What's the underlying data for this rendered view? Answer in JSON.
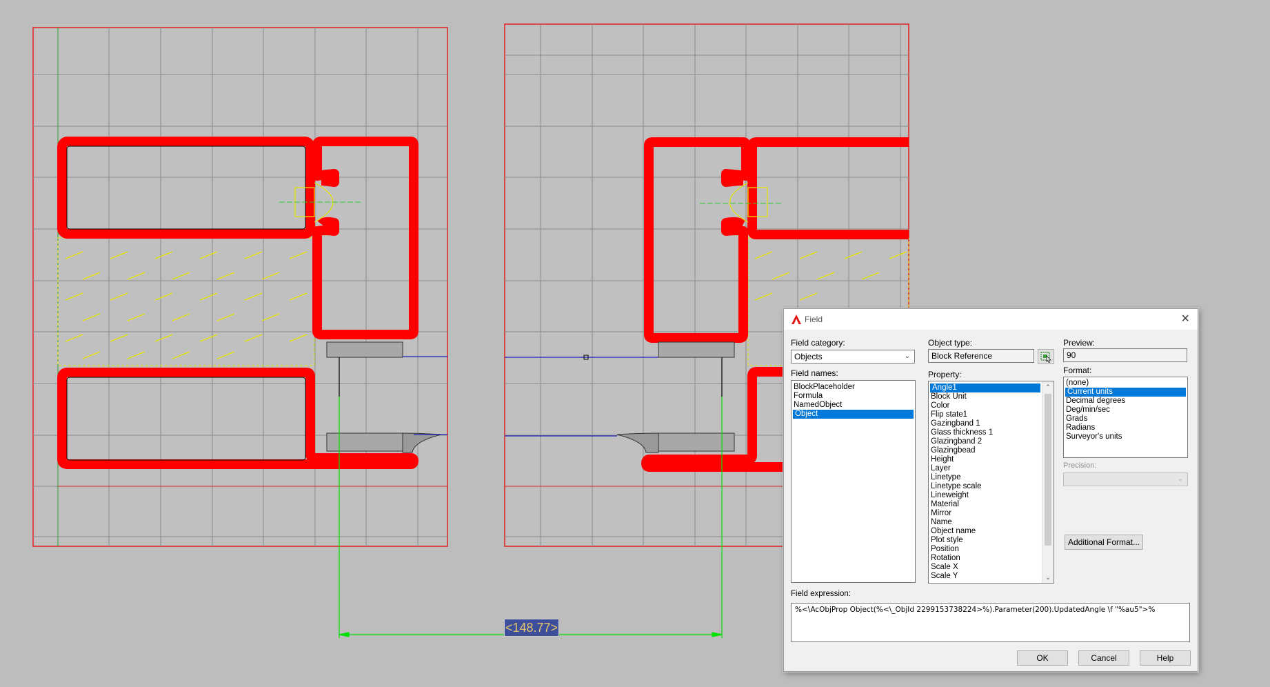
{
  "dimension": {
    "text": "<148.77>"
  },
  "dialog": {
    "title": "Field",
    "field_category": {
      "label": "Field category:",
      "value": "Objects"
    },
    "field_names": {
      "label": "Field names:",
      "items": [
        "BlockPlaceholder",
        "Formula",
        "NamedObject",
        "Object"
      ],
      "selected": "Object"
    },
    "object_type": {
      "label": "Object type:",
      "value": "Block Reference"
    },
    "property": {
      "label": "Property:",
      "items": [
        "Angle1",
        "Block Unit",
        "Color",
        "Flip state1",
        "Gazingband 1",
        "Glass thickness 1",
        "Glazingband 2",
        "Glazingbead",
        "Height",
        "Layer",
        "Linetype",
        "Linetype scale",
        "Lineweight",
        "Material",
        "Mirror",
        "Name",
        "Object name",
        "Plot style",
        "Position",
        "Rotation",
        "Scale X",
        "Scale Y"
      ],
      "selected": "Angle1"
    },
    "preview": {
      "label": "Preview:",
      "value": "90"
    },
    "format": {
      "label": "Format:",
      "items": [
        "(none)",
        "Current units",
        "Decimal degrees",
        "Deg/min/sec",
        "Grads",
        "Radians",
        "Surveyor's units"
      ],
      "selected": "Current units"
    },
    "precision": {
      "label": "Precision:",
      "value": ""
    },
    "additional_format_label": "Additional Format...",
    "field_expression": {
      "label": "Field expression:",
      "value": "%<\\AcObjProp Object(%<\\_ObjId 2299153738224>%).Parameter(200).UpdatedAngle \\f \"%au5\">%"
    },
    "ok_label": "OK",
    "cancel_label": "Cancel",
    "help_label": "Help"
  },
  "colors": {
    "background": "#bdbdbd",
    "profile": "#ff0000",
    "grid": "#8a8a8a",
    "hatch": "#e6e600",
    "dimension": "#00ff00",
    "selection": "#0078d7"
  }
}
